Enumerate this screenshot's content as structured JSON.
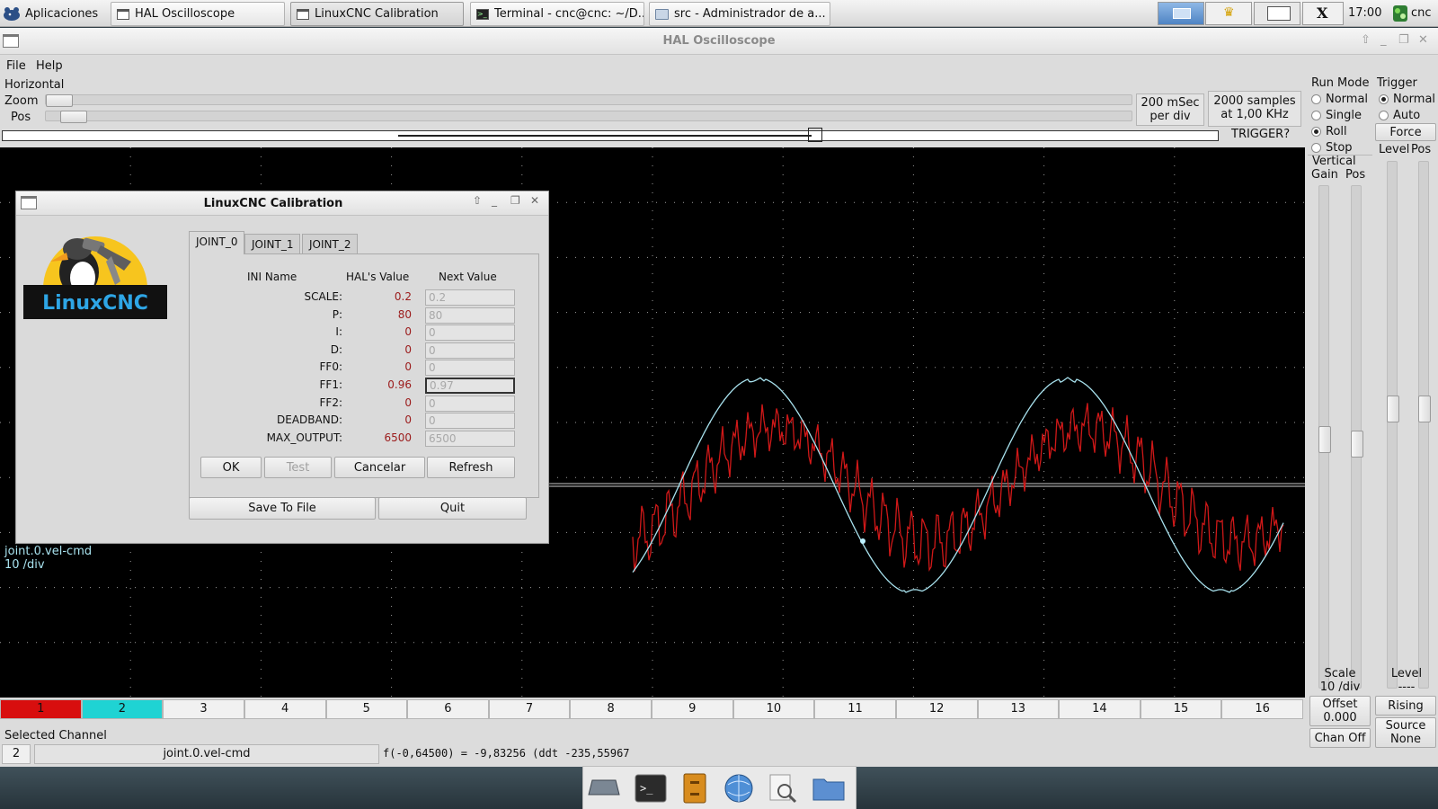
{
  "taskbar": {
    "apps_label": "Aplicaciones",
    "tasks": [
      {
        "label": "HAL Oscilloscope"
      },
      {
        "label": "LinuxCNC Calibration"
      },
      {
        "label": "Terminal - cnc@cnc: ~/D..."
      },
      {
        "label": "src - Administrador de a..."
      }
    ],
    "clock": "17:00",
    "user": "cnc"
  },
  "window": {
    "title": "HAL Oscilloscope",
    "menu": {
      "file": "File",
      "help": "Help"
    }
  },
  "horizontal": {
    "section": "Horizontal",
    "zoom_label": "Zoom",
    "pos_label": "Pos",
    "timebase_line1": "200 mSec",
    "timebase_line2": "per div",
    "samples_line1": "2000 samples",
    "samples_line2": "at 1,00 KHz",
    "trigger_status": "TRIGGER?"
  },
  "run_mode": {
    "title": "Run Mode",
    "options": [
      "Normal",
      "Single",
      "Roll",
      "Stop"
    ],
    "selected": "Roll"
  },
  "trigger": {
    "title": "Trigger",
    "options": [
      "Normal",
      "Auto"
    ],
    "selected": "Normal",
    "force_label": "Force",
    "level_label": "Level",
    "pos_label": "Pos",
    "level_header": "Level",
    "level_value": "----",
    "edge_label": "Rising",
    "source_line1": "Source",
    "source_line2": "None"
  },
  "vertical": {
    "title": "Vertical",
    "gain_label": "Gain",
    "pos_label": "Pos",
    "scale_line1": "Scale",
    "scale_line2": "10 /div",
    "offset_line1": "Offset",
    "offset_line2": "0.000",
    "chan_off_label": "Chan Off"
  },
  "scope": {
    "channel_label": "joint.0.vel-cmd",
    "channel_scale": "10 /div",
    "trace_colors": {
      "ch1": "#d01818",
      "ch2": "#a8e2ee"
    }
  },
  "channels": [
    "1",
    "2",
    "3",
    "4",
    "5",
    "6",
    "7",
    "8",
    "9",
    "10",
    "11",
    "12",
    "13",
    "14",
    "15",
    "16"
  ],
  "channel_colors": {
    "1": "#d80e0e",
    "2": "#1fd3d3"
  },
  "selected_channel": {
    "label": "Selected Channel",
    "number": "2",
    "name": "joint.0.vel-cmd",
    "readout": "f(-0,64500) = -9,83256 (ddt -235,55967"
  },
  "calibration": {
    "title": "LinuxCNC Calibration",
    "logo_text": "LinuxCNC",
    "tabs": [
      "JOINT_0",
      "JOINT_1",
      "JOINT_2"
    ],
    "active_tab": "JOINT_0",
    "headers": {
      "ini": "INI Name",
      "hal": "HAL's Value",
      "next": "Next Value"
    },
    "rows": [
      {
        "name": "SCALE:",
        "hal": "0.2",
        "next": "0.2"
      },
      {
        "name": "P:",
        "hal": "80",
        "next": "80"
      },
      {
        "name": "I:",
        "hal": "0",
        "next": "0"
      },
      {
        "name": "D:",
        "hal": "0",
        "next": "0"
      },
      {
        "name": "FF0:",
        "hal": "0",
        "next": "0"
      },
      {
        "name": "FF1:",
        "hal": "0.96",
        "next": "0.97"
      },
      {
        "name": "FF2:",
        "hal": "0",
        "next": "0"
      },
      {
        "name": "DEADBAND:",
        "hal": "0",
        "next": "0"
      },
      {
        "name": "MAX_OUTPUT:",
        "hal": "6500",
        "next": "6500"
      }
    ],
    "buttons": {
      "ok": "OK",
      "test": "Test",
      "cancel": "Cancelar",
      "refresh": "Refresh",
      "save": "Save To File",
      "quit": "Quit"
    }
  }
}
